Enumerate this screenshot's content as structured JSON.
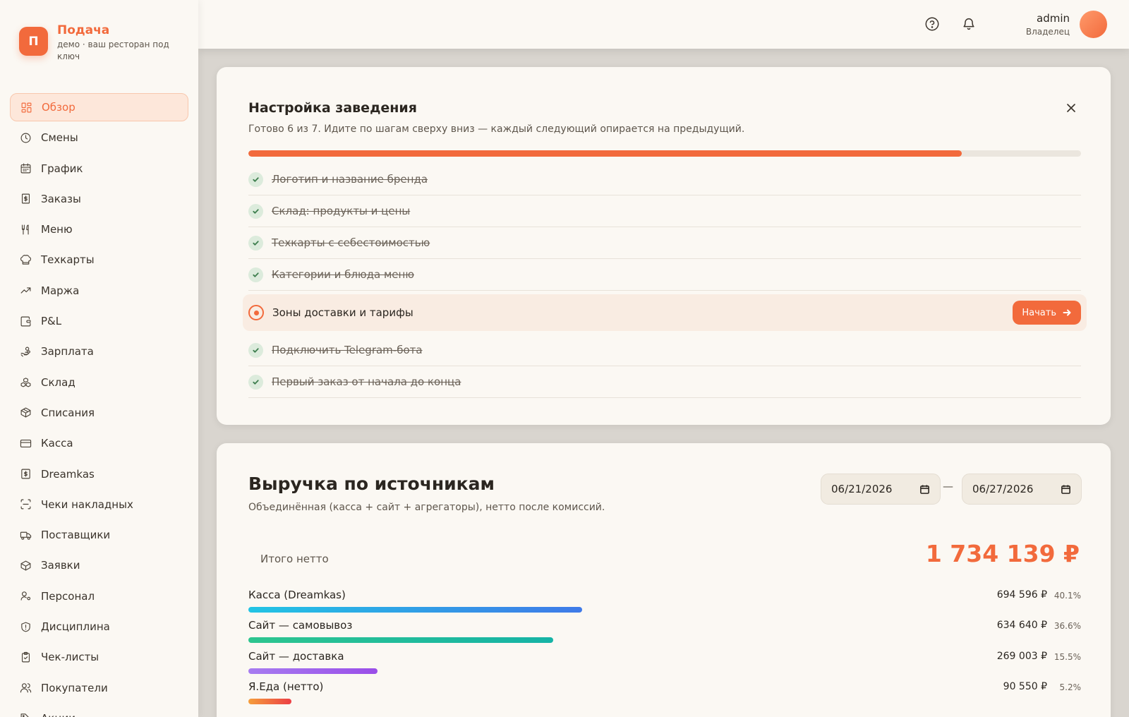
{
  "brand": {
    "logo_letter": "П",
    "name": "Подача",
    "subtitle": "демо · ваш ресторан под ключ"
  },
  "sidebar": {
    "items": [
      {
        "label": "Обзор",
        "icon": "dashboard-icon",
        "active": true
      },
      {
        "label": "Смены",
        "icon": "clock-icon"
      },
      {
        "label": "График",
        "icon": "calendar-icon"
      },
      {
        "label": "Заказы",
        "icon": "receipt-icon"
      },
      {
        "label": "Меню",
        "icon": "fork-knife-icon"
      },
      {
        "label": "Техкарты",
        "icon": "chef-hat-icon"
      },
      {
        "label": "Маржа",
        "icon": "trend-up-icon"
      },
      {
        "label": "P&L",
        "icon": "wallet-icon"
      },
      {
        "label": "Зарплата",
        "icon": "hand-coins-icon"
      },
      {
        "label": "Склад",
        "icon": "boxes-icon"
      },
      {
        "label": "Списания",
        "icon": "package-icon"
      },
      {
        "label": "Касса",
        "icon": "credit-card-icon"
      },
      {
        "label": "Dreamkas",
        "icon": "receipt-dollar-icon"
      },
      {
        "label": "Чеки накладных",
        "icon": "scan-icon"
      },
      {
        "label": "Поставщики",
        "icon": "truck-icon"
      },
      {
        "label": "Заявки",
        "icon": "box-icon"
      },
      {
        "label": "Персонал",
        "icon": "user-gear-icon"
      },
      {
        "label": "Дисциплина",
        "icon": "shield-alert-icon"
      },
      {
        "label": "Чек-листы",
        "icon": "clipboard-check-icon"
      },
      {
        "label": "Покупатели",
        "icon": "users-icon"
      },
      {
        "label": "Акции",
        "icon": "tag-icon"
      }
    ]
  },
  "topbar": {
    "help_icon": "help-circle-icon",
    "bell_icon": "bell-icon",
    "user_name": "admin",
    "user_role": "Владелец"
  },
  "setup": {
    "title": "Настройка заведения",
    "subtitle": "Готово 6 из 7. Идите по шагам сверху вниз — каждый следующий опирается на предыдущий.",
    "progress_done": 6,
    "progress_total": 7,
    "start_label": "Начать",
    "steps": [
      {
        "label": "Логотип и название бренда",
        "done": true
      },
      {
        "label": "Склад: продукты и цены",
        "done": true
      },
      {
        "label": "Техкарты с себестоимостью",
        "done": true
      },
      {
        "label": "Категории и блюда меню",
        "done": true
      },
      {
        "label": "Зоны доставки и тарифы",
        "done": false
      },
      {
        "label": "Подключить Telegram-бота",
        "done": true
      },
      {
        "label": "Первый заказ от начала до конца",
        "done": true
      }
    ]
  },
  "revenue": {
    "title": "Выручка по источникам",
    "subtitle": "Объединённая (касса + сайт + агрегаторы), нетто после комиссий.",
    "date_from": "06/21/2026",
    "date_to": "06/27/2026",
    "date_separator": "—",
    "total_label": "Итого нетто",
    "total_value": "1 734 139 ₽",
    "sources": [
      {
        "name": "Касса (Dreamkas)",
        "amount": "694 596 ₽",
        "pct": "40.1%",
        "share": 0.401,
        "gradient": [
          "#22c4e4",
          "#3f7ae8"
        ]
      },
      {
        "name": "Сайт — самовывоз",
        "amount": "634 640 ₽",
        "pct": "36.6%",
        "share": 0.366,
        "gradient": [
          "#2dc58f",
          "#16b3a6"
        ]
      },
      {
        "name": "Сайт — доставка",
        "amount": "269 003 ₽",
        "pct": "15.5%",
        "share": 0.155,
        "gradient": [
          "#a77cf0",
          "#9a4ee8"
        ]
      },
      {
        "name": "Я.Еда (нетто)",
        "amount": "90 550 ₽",
        "pct": "5.2%",
        "share": 0.052,
        "gradient": [
          "#f59e3c",
          "#ec3f45"
        ]
      }
    ]
  },
  "colors": {
    "accent": "#f26a3c",
    "background": "#fbf8f3"
  }
}
